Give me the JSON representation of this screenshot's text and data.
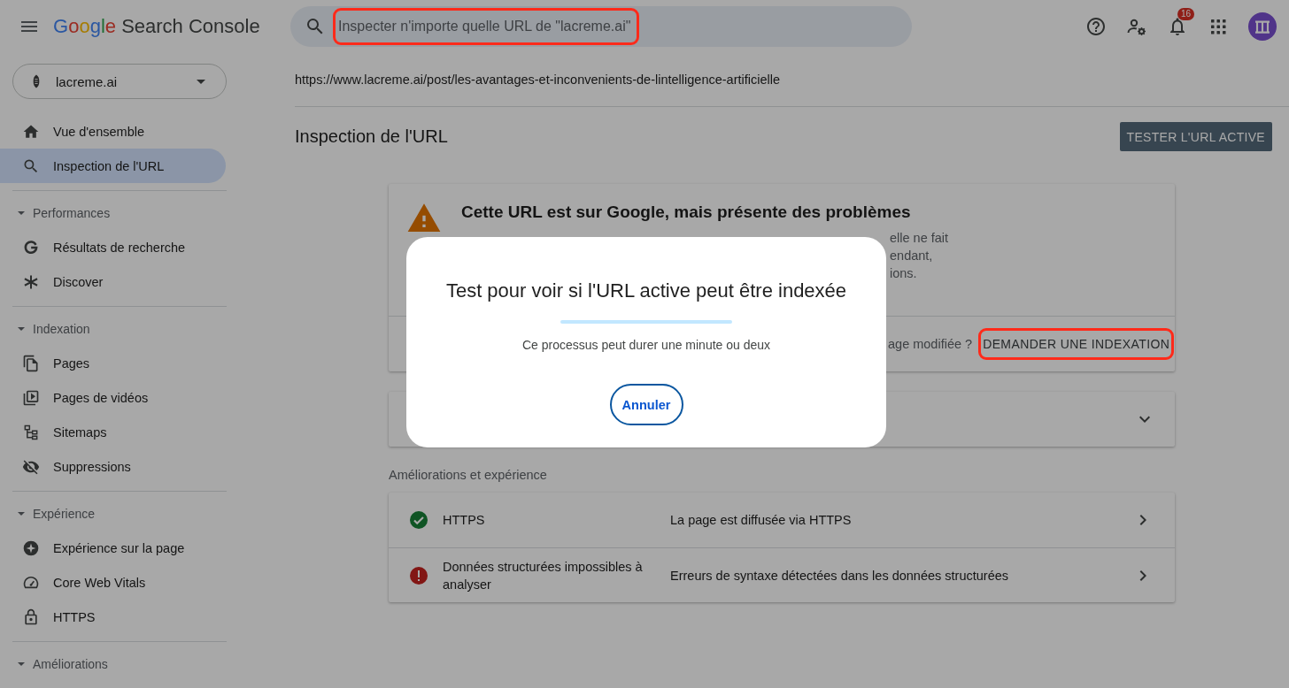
{
  "header": {
    "product": {
      "brand": "Google",
      "name": "Search Console"
    },
    "search": {
      "placeholder": "Inspecter n'importe quelle URL de \"lacreme.ai\"",
      "highlighted": true
    },
    "notifications": {
      "count": "16"
    }
  },
  "sidebar": {
    "property": "lacreme.ai",
    "groups": [
      {
        "items": [
          {
            "label": "Vue d'ensemble",
            "selected": false
          },
          {
            "label": "Inspection de l'URL",
            "selected": true
          }
        ]
      },
      {
        "title": "Performances",
        "expanded": true,
        "items": [
          {
            "label": "Résultats de recherche",
            "selected": false
          },
          {
            "label": "Discover",
            "selected": false
          }
        ]
      },
      {
        "title": "Indexation",
        "expanded": true,
        "items": [
          {
            "label": "Pages",
            "selected": false
          },
          {
            "label": "Pages de vidéos",
            "selected": false
          },
          {
            "label": "Sitemaps",
            "selected": false
          },
          {
            "label": "Suppressions",
            "selected": false
          }
        ]
      },
      {
        "title": "Expérience",
        "expanded": true,
        "items": [
          {
            "label": "Expérience sur la page",
            "selected": false
          },
          {
            "label": "Core Web Vitals",
            "selected": false
          },
          {
            "label": "HTTPS",
            "selected": false
          }
        ]
      },
      {
        "title": "Améliorations",
        "expanded": true
      }
    ]
  },
  "url": "https://www.lacreme.ai/post/les-avantages-et-inconvenients-de-lintelligence-artificielle",
  "page_title": "Inspection de l'URL",
  "test_button": "TESTER L'URL ACTIVE",
  "status_card": {
    "kind": "warning",
    "title": "Cette URL est sur Google, mais présente des problèmes",
    "description_lines": [
      "elle ne fait",
      "endant,",
      "ions."
    ],
    "prompt": "age modifiée ?",
    "request_button": {
      "label": "DEMANDER UNE INDEXATION",
      "highlighted": true
    }
  },
  "collapsed_card": {
    "expanded": false
  },
  "enhancements": {
    "title": "Améliorations et expérience",
    "rows": [
      {
        "kind": "ok",
        "name": "HTTPS",
        "detail": "La page est diffusée via HTTPS"
      },
      {
        "kind": "error",
        "name": "Données structurées impossibles à analyser",
        "detail": "Erreurs de syntaxe détectées dans les données structurées"
      }
    ]
  },
  "dialog": {
    "title": "Test pour voir si l'URL active peut être indexée",
    "message": "Ce processus peut durer une minute ou deux",
    "cancel_button": "Annuler"
  }
}
